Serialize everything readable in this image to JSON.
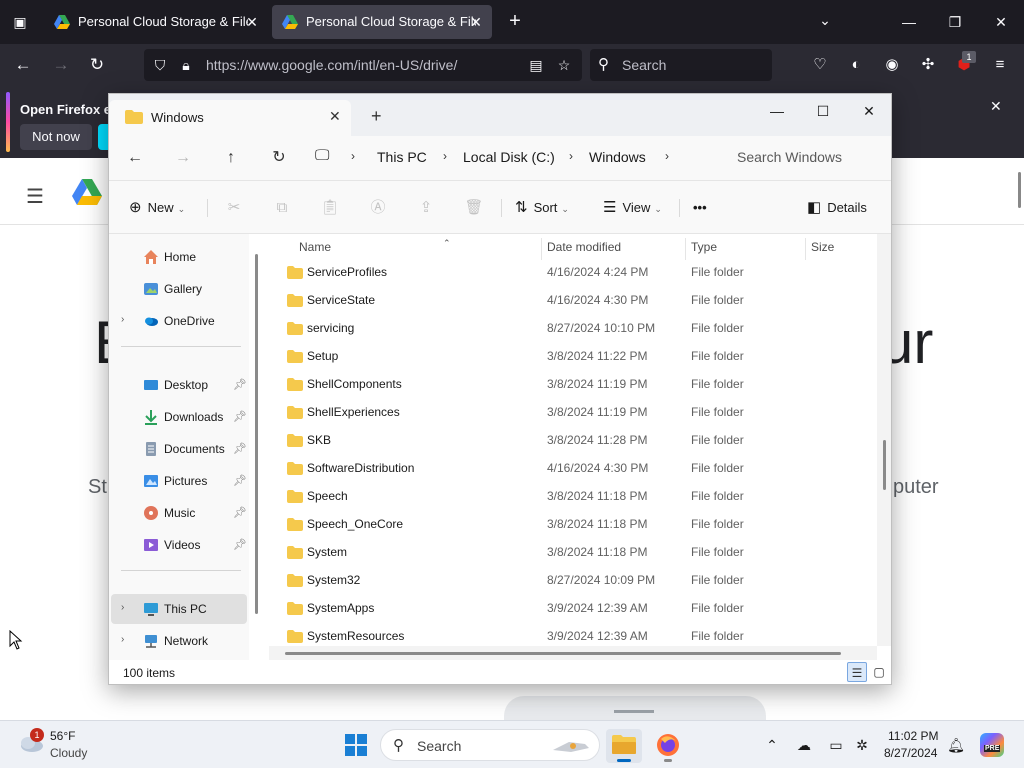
{
  "browser": {
    "tabs": [
      {
        "title": "Personal Cloud Storage & File S"
      },
      {
        "title": "Personal Cloud Storage & File S"
      }
    ],
    "url": "https://www.google.com/intl/en-US/drive/",
    "search_placeholder": "Search",
    "extension_badge": "1"
  },
  "notification": {
    "message": "Open Firefox ev",
    "not_now": "Not now"
  },
  "webpage": {
    "headline_left": "E",
    "headline_right": "ur",
    "subtext_left": "St",
    "subtext_right": "puter"
  },
  "explorer": {
    "tab_title": "Windows",
    "breadcrumbs": [
      "This PC",
      "Local Disk (C:)",
      "Windows"
    ],
    "search_placeholder": "Search Windows",
    "commands": {
      "new": "New",
      "sort": "Sort",
      "view": "View",
      "more": "•••",
      "details": "Details"
    },
    "nav_items": [
      {
        "label": "Home",
        "icon": "home-icon"
      },
      {
        "label": "Gallery",
        "icon": "gallery-icon"
      },
      {
        "label": "OneDrive",
        "icon": "onedrive-icon"
      },
      {
        "label": "Desktop",
        "icon": "desktop-icon"
      },
      {
        "label": "Downloads",
        "icon": "downloads-icon"
      },
      {
        "label": "Documents",
        "icon": "documents-icon"
      },
      {
        "label": "Pictures",
        "icon": "pictures-icon"
      },
      {
        "label": "Music",
        "icon": "music-icon"
      },
      {
        "label": "Videos",
        "icon": "videos-icon"
      },
      {
        "label": "This PC",
        "icon": "this-pc-icon"
      },
      {
        "label": "Network",
        "icon": "network-icon"
      }
    ],
    "columns": [
      "Name",
      "Date modified",
      "Type",
      "Size"
    ],
    "files": [
      {
        "name": "ServiceProfiles",
        "date": "4/16/2024 4:24 PM",
        "type": "File folder"
      },
      {
        "name": "ServiceState",
        "date": "4/16/2024 4:30 PM",
        "type": "File folder"
      },
      {
        "name": "servicing",
        "date": "8/27/2024 10:10 PM",
        "type": "File folder"
      },
      {
        "name": "Setup",
        "date": "3/8/2024 11:22 PM",
        "type": "File folder"
      },
      {
        "name": "ShellComponents",
        "date": "3/8/2024 11:19 PM",
        "type": "File folder"
      },
      {
        "name": "ShellExperiences",
        "date": "3/8/2024 11:19 PM",
        "type": "File folder"
      },
      {
        "name": "SKB",
        "date": "3/8/2024 11:28 PM",
        "type": "File folder"
      },
      {
        "name": "SoftwareDistribution",
        "date": "4/16/2024 4:30 PM",
        "type": "File folder"
      },
      {
        "name": "Speech",
        "date": "3/8/2024 11:18 PM",
        "type": "File folder"
      },
      {
        "name": "Speech_OneCore",
        "date": "3/8/2024 11:18 PM",
        "type": "File folder"
      },
      {
        "name": "System",
        "date": "3/8/2024 11:18 PM",
        "type": "File folder"
      },
      {
        "name": "System32",
        "date": "8/27/2024 10:09 PM",
        "type": "File folder"
      },
      {
        "name": "SystemApps",
        "date": "3/9/2024 12:39 AM",
        "type": "File folder"
      },
      {
        "name": "SystemResources",
        "date": "3/9/2024 12:39 AM",
        "type": "File folder"
      }
    ],
    "status": "100 items"
  },
  "taskbar": {
    "temperature": "56°F",
    "condition": "Cloudy",
    "weather_badge": "1",
    "search_placeholder": "Search",
    "time": "11:02 PM",
    "date": "8/27/2024",
    "copilot_label": "PRE"
  },
  "colors": {
    "folder": "#f5c94c",
    "firefox_dark": "#1c1b22",
    "accent_blue": "#0067c0"
  }
}
